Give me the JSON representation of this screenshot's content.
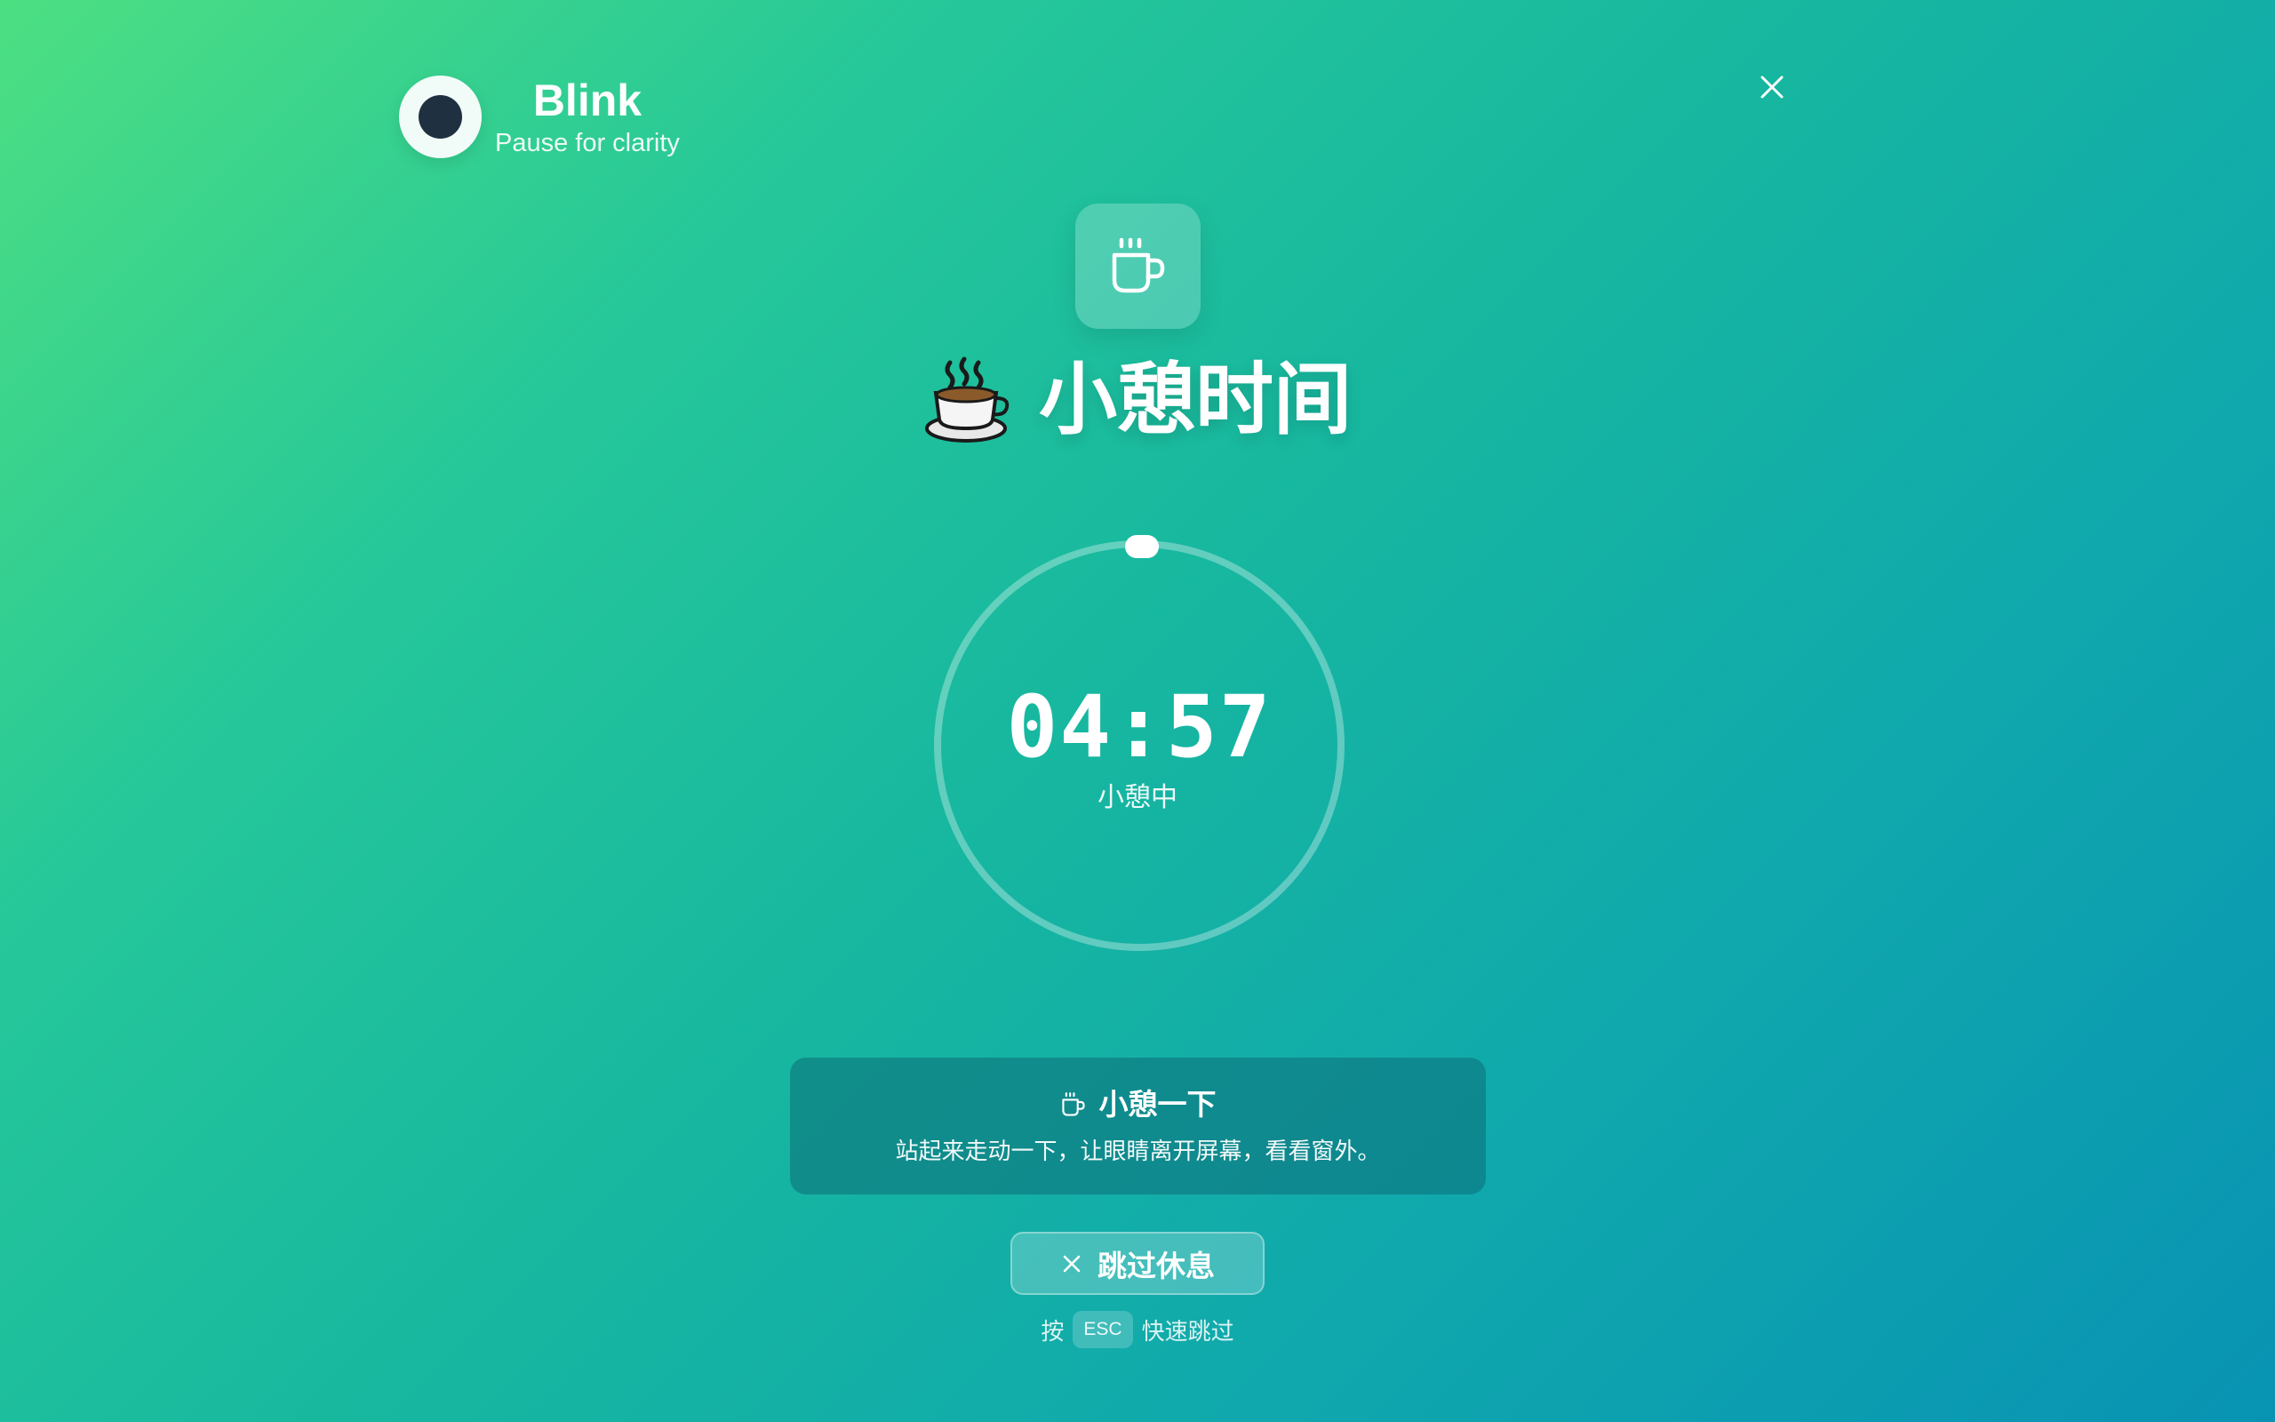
{
  "app": {
    "name": "Blink",
    "tagline": "Pause for clarity"
  },
  "break": {
    "title": "小憩时间",
    "title_emoji": "hot-beverage",
    "countdown": "04:57",
    "status": "小憩中",
    "progress": 0.99
  },
  "tip": {
    "title": "小憩一下",
    "body": "站起来走动一下，让眼睛离开屏幕，看看窗外。"
  },
  "skip": {
    "label": "跳过休息"
  },
  "esc_hint": {
    "prefix": "按",
    "key": "ESC",
    "suffix": "快速跳过"
  },
  "icons": {
    "close": "close-icon",
    "cup": "coffee-cup-icon",
    "skip": "x-icon"
  },
  "colors": {
    "gradient_start": "#4ddf82",
    "gradient_end": "#0893b3",
    "logo_dot": "#1f3140"
  }
}
